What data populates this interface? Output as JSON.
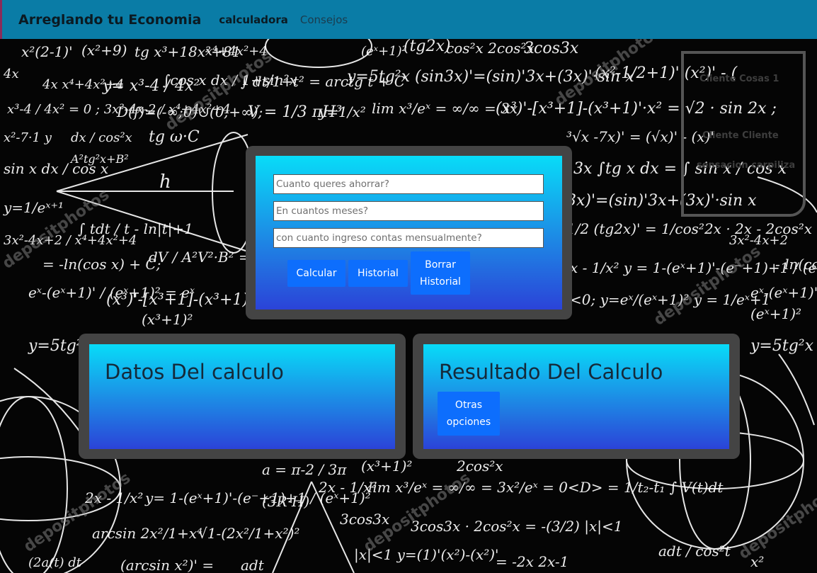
{
  "navbar": {
    "brand": "Arreglando tu Economia",
    "links": [
      {
        "label": "calculadora"
      },
      {
        "label": "Consejos"
      }
    ]
  },
  "aside": {
    "items": [
      "Cliente Cosas 1",
      "Cliente Cliente",
      "sensacion carpiliza"
    ]
  },
  "calculator": {
    "fields": [
      {
        "placeholder": "Cuanto queres ahorrar?"
      },
      {
        "placeholder": "En cuantos meses?"
      },
      {
        "placeholder": "con cuanto ingreso contas mensualmente?"
      }
    ],
    "buttons": {
      "calcular": "Calcular",
      "historial": "Historial",
      "borrar": "Borrar Historial"
    }
  },
  "datos": {
    "title": "Datos Del calculo"
  },
  "resultado": {
    "title": "Resultado Del Calculo",
    "otras_label": "Otras opciones"
  },
  "colors": {
    "navbar": "#0a7ca6",
    "panel_frame": "#444444",
    "button": "#0d6efd",
    "gradient_top": "#08dcf8",
    "gradient_bottom": "#2b43d8"
  }
}
